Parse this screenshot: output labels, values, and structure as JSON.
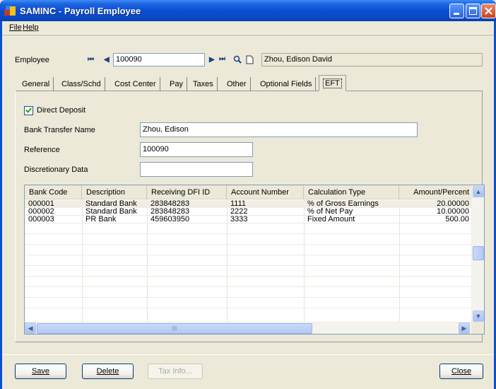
{
  "window": {
    "title": "SAMINC - Payroll Employee",
    "menu": [
      "File",
      "Help"
    ]
  },
  "employee": {
    "label": "Employee",
    "id": "100090",
    "name": "Zhou, Edison David"
  },
  "tabs": [
    {
      "label": "General"
    },
    {
      "label": "Class/Schd"
    },
    {
      "label": "Cost Center"
    },
    {
      "label": "Pay"
    },
    {
      "label": "Taxes"
    },
    {
      "label": "Other"
    },
    {
      "label": "Optional Fields"
    },
    {
      "label": "EFT",
      "active": true
    }
  ],
  "eft": {
    "direct_deposit_label": "Direct Deposit",
    "direct_deposit_checked": true,
    "bank_transfer_label": "Bank Transfer Name",
    "bank_transfer_value": "Zhou, Edison",
    "reference_label": "Reference",
    "reference_value": "100090",
    "discretionary_label": "Discretionary Data",
    "discretionary_value": ""
  },
  "grid": {
    "columns": [
      "Bank Code",
      "Description",
      "Receiving DFI ID",
      "Account Number",
      "Calculation Type",
      "Amount/Percent"
    ],
    "rows": [
      [
        "000001",
        "Standard Bank",
        "283848283",
        "1111",
        "% of Gross Earnings",
        "20.00000"
      ],
      [
        "000002",
        "Standard Bank",
        "283848283",
        "2222",
        "% of Net Pay",
        "10.00000"
      ],
      [
        "000003",
        "PR Bank",
        "459603950",
        "3333",
        "Fixed Amount",
        "500.00"
      ]
    ]
  },
  "buttons": {
    "save": "Save",
    "delete": "Delete",
    "tax_info": "Tax Info...",
    "close": "Close"
  },
  "colors": {
    "titlebar": "#0a4fd4",
    "window_bg": "#ece9d8"
  }
}
